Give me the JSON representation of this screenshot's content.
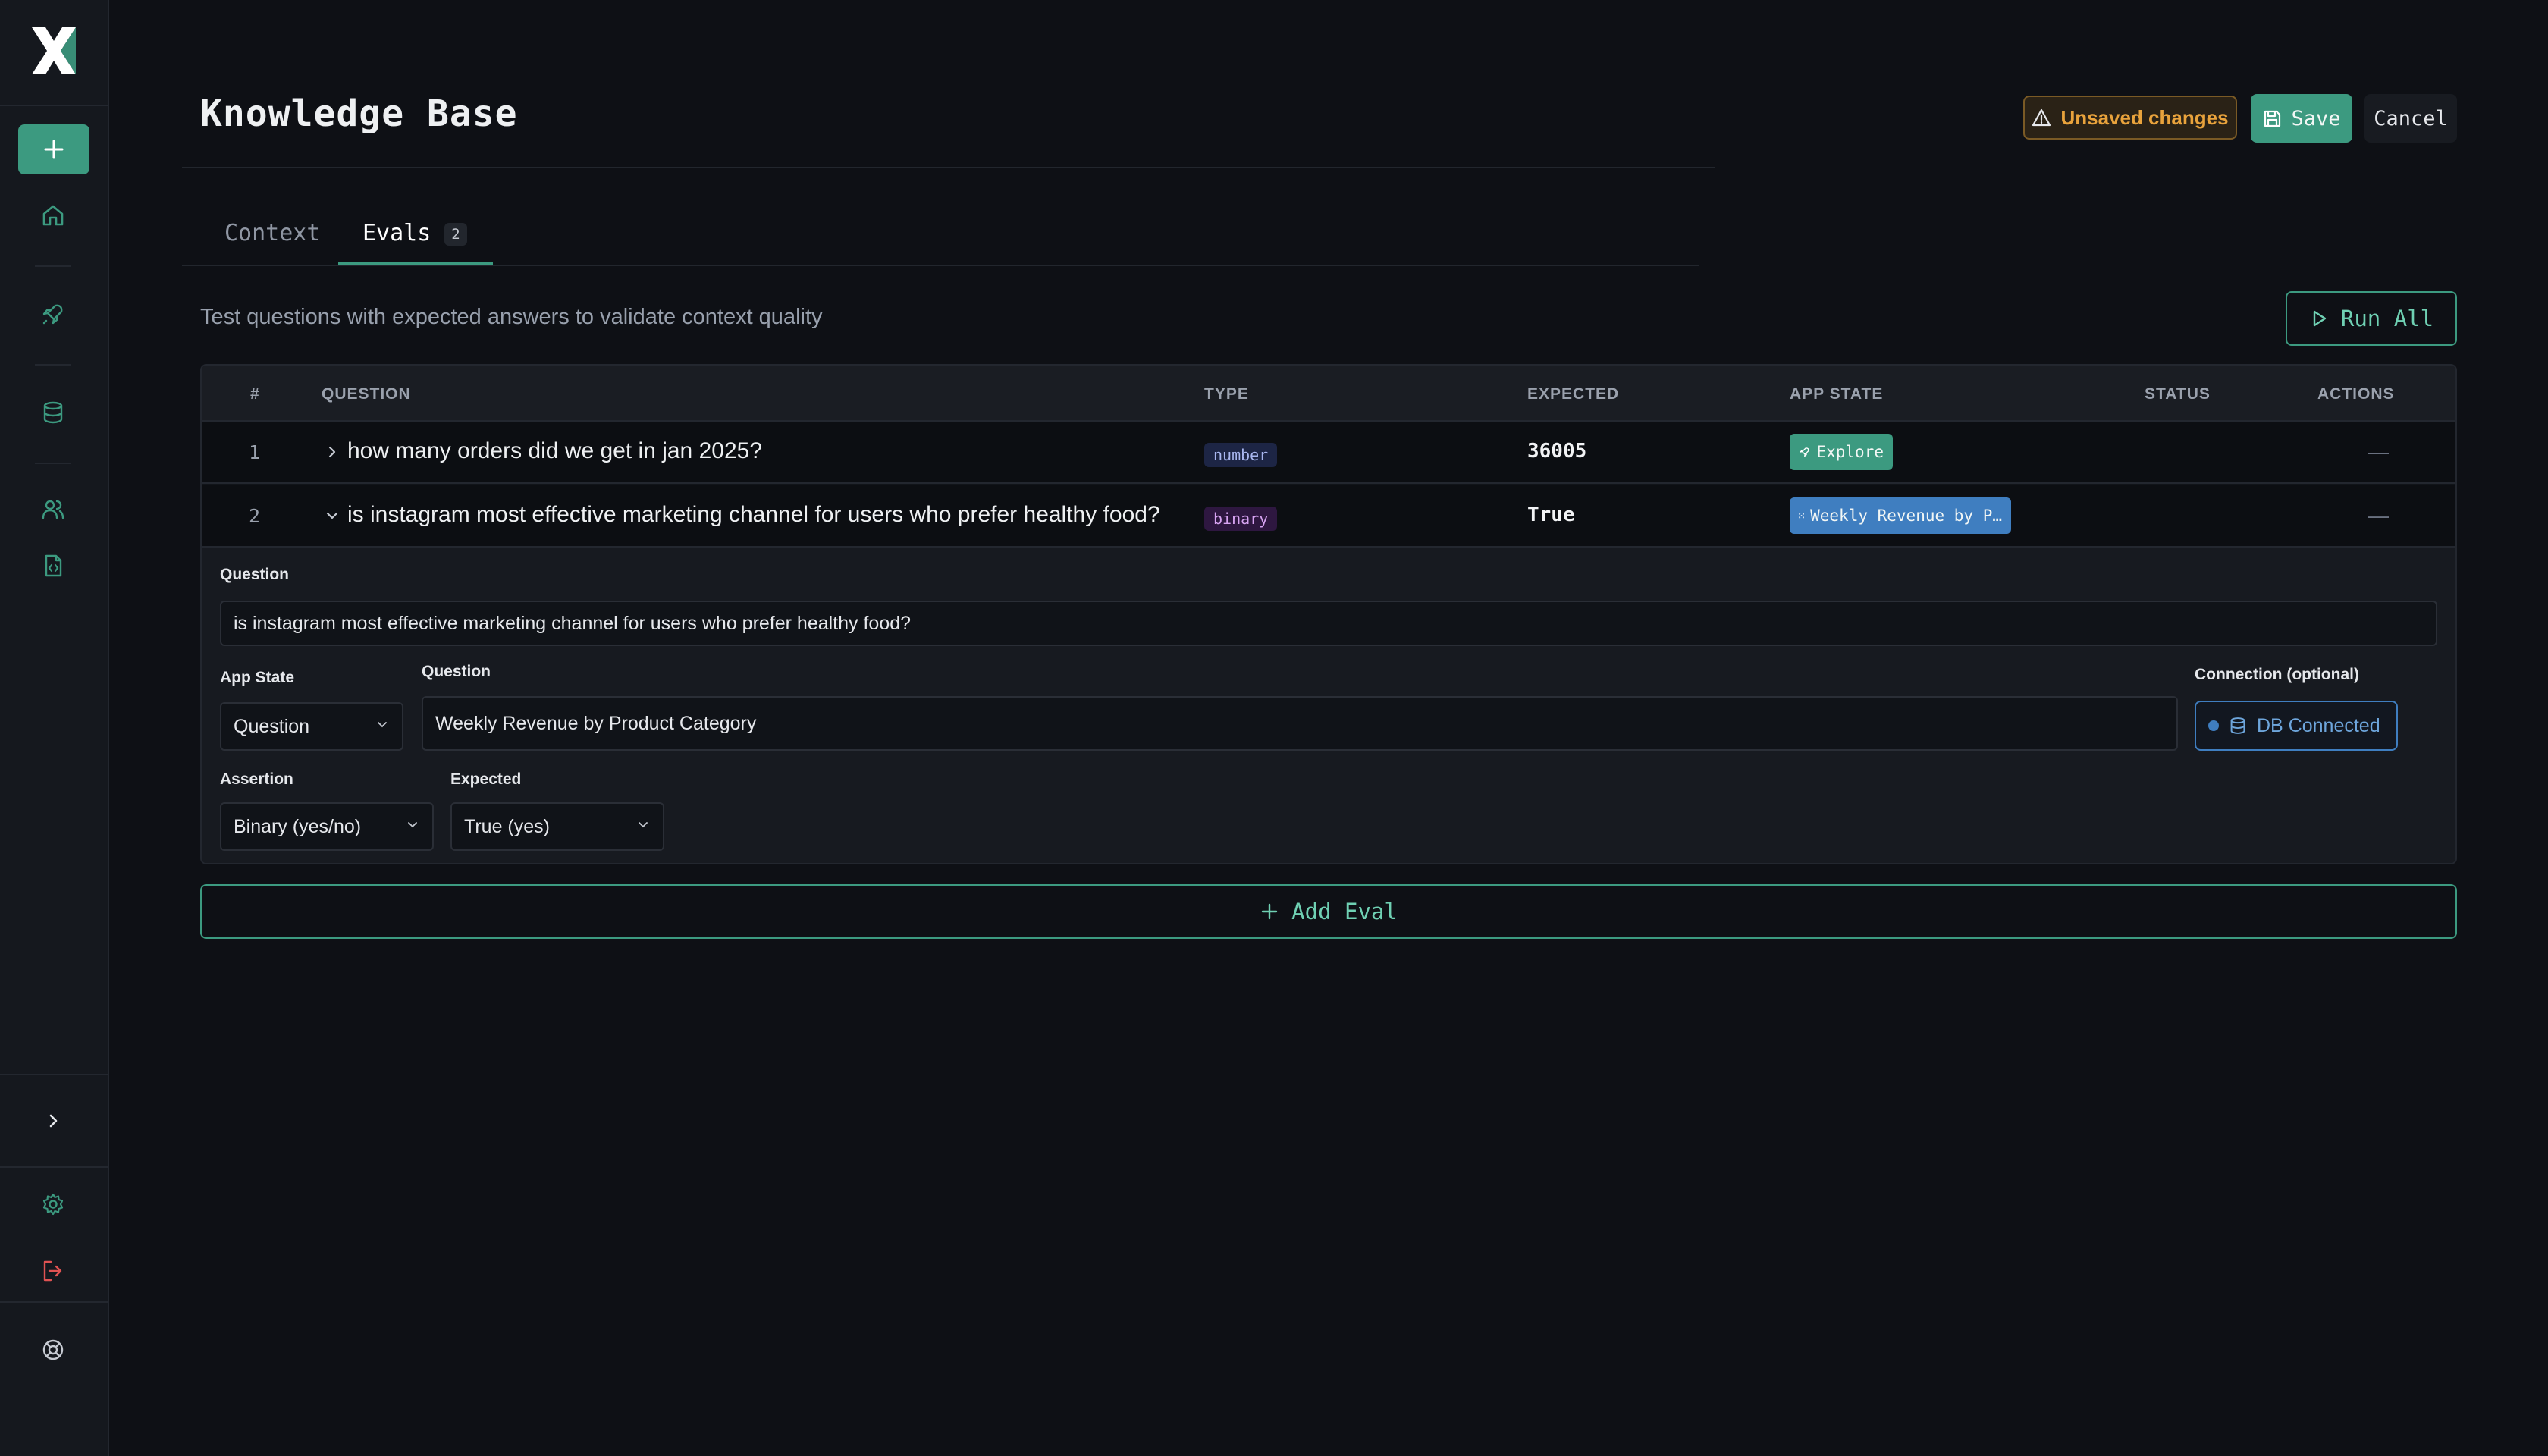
{
  "header": {
    "title": "Knowledge Base",
    "unsaved": "Unsaved changes",
    "save": "Save",
    "cancel": "Cancel"
  },
  "tabs": [
    {
      "label": "Context",
      "active": false
    },
    {
      "label": "Evals",
      "active": true,
      "count": "2"
    }
  ],
  "description": "Test questions with expected answers to validate context quality",
  "run_all": "Run All",
  "table": {
    "headers": [
      "#",
      "QUESTION",
      "TYPE",
      "EXPECTED",
      "APP STATE",
      "STATUS",
      "ACTIONS"
    ],
    "rows": [
      {
        "num": "1",
        "question": "how many orders did we get in jan 2025?",
        "type": "number",
        "expected": "36005",
        "app_state": "Explore",
        "status": "—"
      },
      {
        "num": "2",
        "question": "is instagram most effective marketing channel for users who prefer healthy food?",
        "type": "binary",
        "expected": "True",
        "app_state": "Weekly Revenue by P…",
        "status": "—"
      }
    ]
  },
  "detail": {
    "question_label": "Question",
    "question_value": "is instagram most effective marketing channel for users who prefer healthy food?",
    "app_state_label": "App State",
    "app_state_value": "Question",
    "question2_label": "Question",
    "question2_value": "Weekly Revenue by Product Category",
    "connection_label": "Connection (optional)",
    "connection_value": "DB Connected",
    "assertion_label": "Assertion",
    "assertion_value": "Binary (yes/no)",
    "expected_label": "Expected",
    "expected_value": "True (yes)"
  },
  "add_eval": "Add Eval",
  "colors": {
    "accent": "#3c9a80",
    "warning": "#e9a33c",
    "info": "#3f7ec0",
    "danger": "#e05252"
  }
}
